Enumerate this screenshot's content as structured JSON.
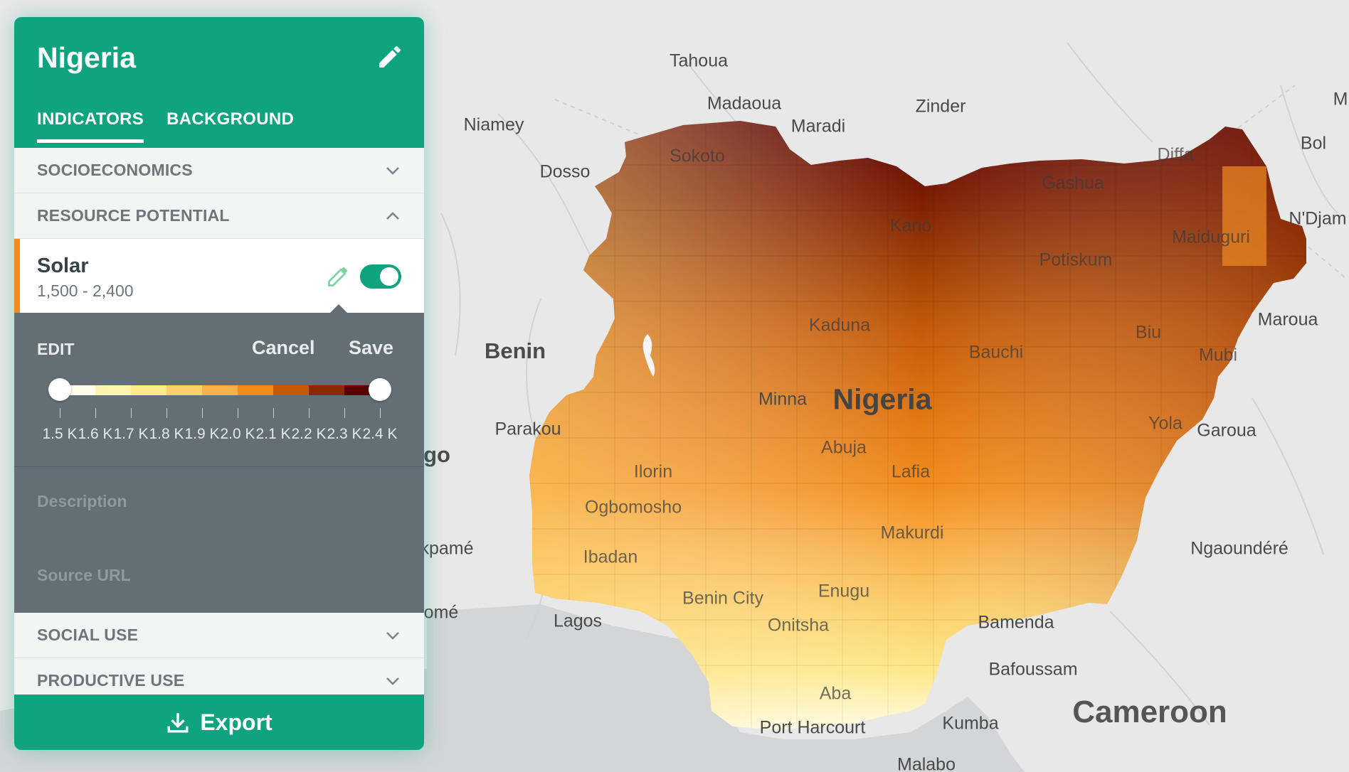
{
  "panel": {
    "title": "Nigeria",
    "tabs": [
      {
        "label": "INDICATORS",
        "active": true
      },
      {
        "label": "BACKGROUND",
        "active": false
      }
    ],
    "sections": {
      "socioeconomics": "SOCIOECONOMICS",
      "resource_potential": "RESOURCE POTENTIAL",
      "social_use": "SOCIAL USE",
      "productive_use": "PRODUCTIVE USE"
    },
    "layer": {
      "name": "Solar",
      "range": "1,500 - 2,400",
      "enabled": true
    },
    "edit": {
      "label": "EDIT",
      "cancel": "Cancel",
      "save": "Save",
      "scale_colors": [
        "#fffde8",
        "#fff3b0",
        "#fde88a",
        "#fbd06a",
        "#f8b04a",
        "#f28c1c",
        "#c45a08",
        "#8a2a03",
        "#5a0000"
      ],
      "tick_labels": [
        "1.5 K",
        "1.6 K",
        "1.7 K",
        "1.8 K",
        "1.9 K",
        "2.0 K",
        "2.1 K",
        "2.2 K",
        "2.3 K",
        "2.4 K"
      ],
      "description_label": "Description",
      "source_label": "Source URL"
    },
    "export_label": "Export"
  },
  "map": {
    "country_labels": {
      "nigeria": "Nigeria",
      "benin": "Benin",
      "cameroon": "Cameroon",
      "togo_partial": "go"
    },
    "places": [
      "Tahoua",
      "Madaoua",
      "Maradi",
      "Zinder",
      "Niamey",
      "Dosso",
      "Sokoto",
      "Diffa",
      "Bol",
      "N'Djam",
      "Gashua",
      "Kano",
      "Maiduguri",
      "Potiskum",
      "Kaduna",
      "Bauchi",
      "Biu",
      "Mubi",
      "Maroua",
      "Minna",
      "Abuja",
      "Lafia",
      "Yola",
      "Garoua",
      "Parakou",
      "Ilorin",
      "Ogbomosho",
      "Ibadan",
      "Makurdi",
      "Ngaoundéré",
      "Lagos",
      "Benin City",
      "Enugu",
      "Onitsha",
      "Bamenda",
      "Bafoussam",
      "Aba",
      "Port Harcourt",
      "Kumba",
      "Malabo",
      "kpamé",
      "omé",
      "M"
    ]
  }
}
